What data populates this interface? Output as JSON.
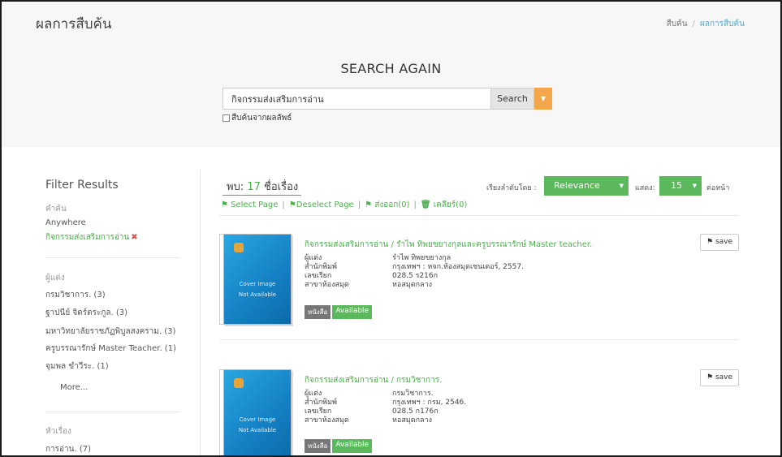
{
  "header": {
    "title": "ผลการสืบค้น",
    "breadcrumb": [
      "สืบค้น",
      "ผลการสืบค้น"
    ]
  },
  "search": {
    "heading": "SEARCH AGAIN",
    "query": "กิจกรรมส่งเสริมการอ่าน",
    "button_label": "Search",
    "within_results_label": "สืบค้นจากผลลัพธ์"
  },
  "sidebar": {
    "title": "Filter Results",
    "keyword_section": {
      "label": "คำค้น",
      "field": "Anywhere",
      "active_value": "กิจกรรมส่งเสริมการอ่าน"
    },
    "author_section": {
      "label": "ผู้แต่ง",
      "items": [
        "กรมวิชาการ. (3)",
        "ฐาปนีย์ จิตร์ตระกูล. (3)",
        "มหาวิทยาลัยราชภัฏพิบูลสงคราม. (3)",
        "ครูบรรณารักษ์ Master Teacher. (1)",
        "จุมพล ขำวีระ. (1)"
      ],
      "more_label": "More..."
    },
    "subject_section": {
      "label": "หัวเรื่อง",
      "items": [
        "การอ่าน. (7)"
      ]
    }
  },
  "results_header": {
    "found_prefix": "พบ:",
    "count": "17",
    "found_suffix": "ชื่อเรื่อง",
    "actions": {
      "select_page": "Select Page",
      "deselect_page": "Deselect Page",
      "export": "ส่งออก(0)",
      "clear": "เคลียร์(0)"
    },
    "sort_label": "เรียงลำดับโดย :",
    "sort_value": "Relevance",
    "show_label": "แสดง:",
    "show_value": "15",
    "per_page_label": "ต่อหน้า"
  },
  "results": [
    {
      "title": "กิจกรรมส่งเสริมการอ่าน / รำไพ ทิพยขยางกุลและครูบรรณารักษ์ Master teacher.",
      "cover_text": [
        "Cover Image",
        "Not Available"
      ],
      "fields": [
        {
          "k": "ผู้แต่ง",
          "v": "รำไพ ทิพยขยางกุล"
        },
        {
          "k": "สำนักพิมพ์",
          "v": "กรุงเทพฯ : หจก.ห้องสมุดเชนเตอร์, 2557."
        },
        {
          "k": "เลขเรียก",
          "v": "028.5 ร216ก"
        },
        {
          "k": "สาขาห้องสมุด",
          "v": "หอสมุดกลาง"
        }
      ],
      "type_badge": "หนังสือ",
      "status_badge": "Available",
      "save_label": "save"
    },
    {
      "title": "กิจกรรมส่งเสริมการอ่าน / กรมวิชาการ.",
      "cover_text": [
        "Cover Image",
        "Not Available"
      ],
      "fields": [
        {
          "k": "ผู้แต่ง",
          "v": "กรมวิชาการ."
        },
        {
          "k": "สำนักพิมพ์",
          "v": "กรุงเทพฯ : กรม, 2546."
        },
        {
          "k": "เลขเรียก",
          "v": "028.5 ก176ก"
        },
        {
          "k": "สาขาห้องสมุด",
          "v": "หอสมุดกลาง"
        }
      ],
      "type_badge": "หนังสือ",
      "status_badge": "Available",
      "save_label": "save"
    }
  ],
  "colors": {
    "accent_green": "#5cb85c",
    "link_green": "#4cae4c",
    "search_dropdown": "#f3a64a",
    "panel_bg": "#f7f7f7"
  }
}
